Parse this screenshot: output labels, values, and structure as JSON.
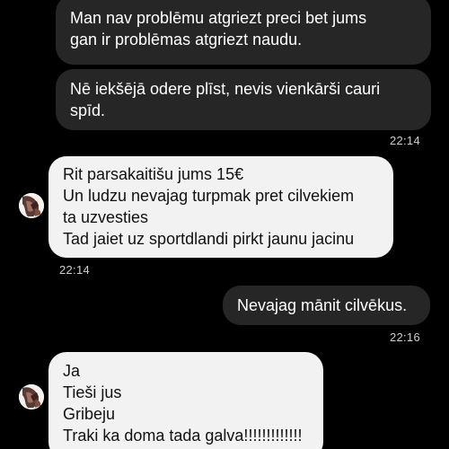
{
  "messages": [
    {
      "direction": "outgoing",
      "lines": [
        "Man nav problēmu atgriezt preci bet jums",
        "gan ir problēmas atgriezt naudu."
      ]
    },
    {
      "direction": "outgoing",
      "lines": [
        "Nē iekšējā odere plīst, nevis vienkārši cauri",
        "spīd."
      ]
    },
    {
      "time": "22:14"
    },
    {
      "direction": "incoming",
      "lines": [
        "Rit parsakaitišu jums 15€",
        "Un ludzu nevajag turpmak pret cilvekiem",
        "ta uzvesties",
        "Tad jaiet uz sportdlandi pirkt jaunu jacinu"
      ]
    },
    {
      "time": "22:14"
    },
    {
      "direction": "outgoing",
      "lines": [
        "Nevajag mānit cilvēkus."
      ]
    },
    {
      "time": "22:16"
    },
    {
      "direction": "incoming",
      "lines": [
        "Ja",
        "Tieši jus",
        "Gribeju",
        "Traki ka doma tada galva!!!!!!!!!!!!!"
      ]
    }
  ],
  "colors": {
    "background": "#000000",
    "outgoing_bubble": "#262626",
    "incoming_bubble": "#f2f2f2"
  },
  "icons": {
    "avatar": "contact-avatar"
  }
}
